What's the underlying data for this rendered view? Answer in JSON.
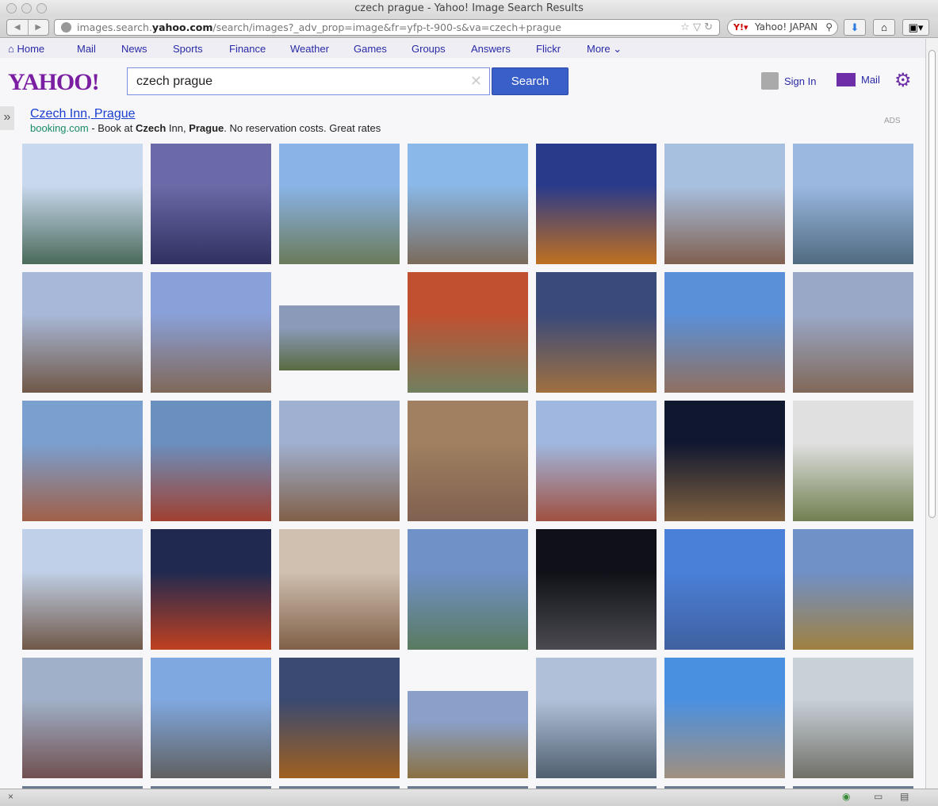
{
  "window": {
    "title": "czech prague - Yahoo! Image Search Results"
  },
  "browser": {
    "url_pre": "images.search.",
    "url_domain": "yahoo.com",
    "url_post": "/search/images?_adv_prop=image&fr=yfp-t-900-s&va=czech+prague",
    "search_engine": "Yahoo! JAPAN",
    "back": "◀",
    "forward": "▶"
  },
  "nav": {
    "items": [
      "Home",
      "Mail",
      "News",
      "Sports",
      "Finance",
      "Weather",
      "Games",
      "Groups",
      "Answers",
      "Flickr",
      "More ⌄"
    ]
  },
  "header": {
    "logo": "YAHOO!",
    "query": "czech prague",
    "search_label": "Search",
    "signin": "Sign In",
    "mail": "Mail"
  },
  "ad": {
    "title": "Czech Inn, Prague",
    "source": "booking.com",
    "dash": " - Book at ",
    "b1": "Czech",
    "mid": " Inn, ",
    "b2": "Prague",
    "rest": ". No reservation costs. Great rates",
    "label": "ADS"
  },
  "side_toggle": "»",
  "tiles": [
    [
      "#c8d8ee",
      "#4a6a5a"
    ],
    [
      "#6a6aa8",
      "#303060"
    ],
    [
      "#8ab4e8",
      "#6a7a5a"
    ],
    [
      "#8ab8e8",
      "#7a6a5a"
    ],
    [
      "#2a3a8a",
      "#c07020"
    ],
    [
      "#a8c0e0",
      "#806050"
    ],
    [
      "#9ab8e0",
      "#506a80"
    ],
    [
      "#a8b8d8",
      "#705848"
    ],
    [
      "#8aa0d8",
      "#806858"
    ],
    [
      "#8a9ab8",
      "#5a6a40"
    ],
    [
      "#c05030",
      "#708060"
    ],
    [
      "#3a4a7a",
      "#a07040"
    ],
    [
      "#5a90d8",
      "#907060"
    ],
    [
      "#9aa8c8",
      "#806858"
    ],
    [
      "#7aa0d0",
      "#a06048"
    ],
    [
      "#6a90c0",
      "#a04030"
    ],
    [
      "#a0b0d0",
      "#806048"
    ],
    [
      "#a08060",
      "#806050"
    ],
    [
      "#a0b8e0",
      "#a05040"
    ],
    [
      "#101830",
      "#806040"
    ],
    [
      "#e0e0e0",
      "#708050"
    ],
    [
      "#c0d0e8",
      "#705848"
    ],
    [
      "#202a50",
      "#c04020"
    ],
    [
      "#d0c0b0",
      "#806048"
    ],
    [
      "#7090c8",
      "#5a7a60"
    ],
    [
      "#101018",
      "#4a4a50"
    ],
    [
      "#4a80d8",
      "#4060a0"
    ],
    [
      "#7090c8",
      "#a08040"
    ],
    [
      "#a0b0c8",
      "#705050"
    ],
    [
      "#80a8e0",
      "#606060"
    ],
    [
      "#3a4a70",
      "#a06020"
    ],
    [
      "#8aa0c8",
      "#8a7040"
    ],
    [
      "#b0c0d8",
      "#506070"
    ],
    [
      "#4a90e0",
      "#a09080"
    ],
    [
      "#c8d0d8",
      "#707068"
    ]
  ],
  "status": {
    "close": "×"
  }
}
